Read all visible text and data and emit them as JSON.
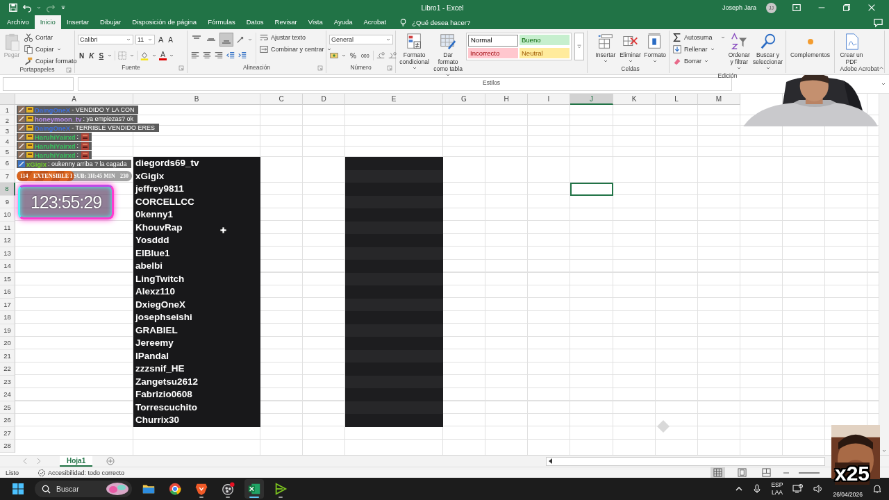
{
  "title_bar": {
    "title": "Libro1  -  Excel",
    "user": "Joseph Jara",
    "avatar": "JJ"
  },
  "ribbon_tabs": [
    {
      "label": "Archivo",
      "selected": false
    },
    {
      "label": "Inicio",
      "selected": true
    },
    {
      "label": "Insertar",
      "selected": false
    },
    {
      "label": "Dibujar",
      "selected": false
    },
    {
      "label": "Disposición de página",
      "selected": false
    },
    {
      "label": "Fórmulas",
      "selected": false
    },
    {
      "label": "Datos",
      "selected": false
    },
    {
      "label": "Revisar",
      "selected": false
    },
    {
      "label": "Vista",
      "selected": false
    },
    {
      "label": "Ayuda",
      "selected": false
    },
    {
      "label": "Acrobat",
      "selected": false
    }
  ],
  "tell_me": "¿Qué desea hacer?",
  "ribbon": {
    "clipboard": {
      "label": "Portapapeles",
      "paste": "Pegar",
      "paste_disabled": true,
      "cut": "Cortar",
      "copy": "Copiar",
      "format_painter": "Copiar formato"
    },
    "font": {
      "label": "Fuente",
      "face": "Calibri",
      "size": "11",
      "grow": "A",
      "shrink": "A",
      "bold": "N",
      "italic": "K",
      "underline": "S",
      "color_button": "A"
    },
    "alignment": {
      "label": "Alineación",
      "vertical": [
        {
          "selected": false
        },
        {
          "selected": false
        },
        {
          "selected": true
        }
      ],
      "wrap": "Ajustar texto",
      "merge": "Combinar y centrar"
    },
    "number": {
      "label": "Número",
      "format": "General",
      "percent": "%",
      "thousands": "000"
    },
    "styles": {
      "label": "Estilos",
      "conditional": "Formato condicional",
      "as_table": "Dar formato como tabla",
      "cell_styles": [
        {
          "label": "Normal",
          "kind": "normal"
        },
        {
          "label": "Bueno",
          "kind": "good"
        },
        {
          "label": "Incorrecto",
          "kind": "bad"
        },
        {
          "label": "Neutral",
          "kind": "neutral"
        }
      ]
    },
    "cells": {
      "label": "Celdas",
      "insert": "Insertar",
      "delete": "Eliminar",
      "format": "Formato"
    },
    "editing": {
      "label": "Edición",
      "autosum": "Autosuma",
      "fill": "Rellenar",
      "clear": "Borrar",
      "sort": "Ordenar y filtrar",
      "find": "Buscar y seleccionar"
    },
    "addins": {
      "button": "Complementos"
    },
    "acrobat": {
      "label": "Adobe Acrobat",
      "create_pdf": "Crear un PDF"
    }
  },
  "columns": [
    {
      "label": "A",
      "kind": "empty",
      "selected": false
    },
    {
      "label": "B",
      "kind": "names",
      "selected": false
    },
    {
      "label": "C",
      "kind": "empty",
      "selected": false
    },
    {
      "label": "D",
      "kind": "empty",
      "selected": false
    },
    {
      "label": "E",
      "kind": "shaded",
      "selected": false
    },
    {
      "label": "G",
      "kind": "empty",
      "selected": false
    },
    {
      "label": "H",
      "kind": "empty",
      "selected": false
    },
    {
      "label": "I",
      "kind": "empty",
      "selected": false
    },
    {
      "label": "J",
      "kind": "empty",
      "selected": true
    },
    {
      "label": "K",
      "kind": "empty",
      "selected": false
    },
    {
      "label": "L",
      "kind": "empty",
      "selected": false
    },
    {
      "label": "M",
      "kind": "empty",
      "selected": false
    }
  ],
  "rows": [
    {
      "label": "1",
      "filled": false,
      "selected": false
    },
    {
      "label": "2",
      "filled": false,
      "selected": false
    },
    {
      "label": "3",
      "filled": false,
      "selected": false
    },
    {
      "label": "4",
      "filled": false,
      "selected": false
    },
    {
      "label": "5",
      "filled": false,
      "selected": false
    },
    {
      "label": "6",
      "name": "diegords69_tv",
      "filled": true,
      "selected": false
    },
    {
      "label": "7",
      "name": "xGigix",
      "filled": true,
      "selected": false
    },
    {
      "label": "8",
      "name": "jeffrey9811",
      "filled": true,
      "selected": true
    },
    {
      "label": "9",
      "name": "CORCELLCC",
      "filled": true,
      "selected": false
    },
    {
      "label": "10",
      "name": "0kenny1",
      "filled": true,
      "selected": false
    },
    {
      "label": "11",
      "name": "KhouvRap",
      "filled": true,
      "selected": false
    },
    {
      "label": "12",
      "name": "Yosddd",
      "filled": true,
      "selected": false
    },
    {
      "label": "13",
      "name": "ElBlue1",
      "filled": true,
      "selected": false
    },
    {
      "label": "14",
      "name": "abelbi",
      "filled": true,
      "selected": false
    },
    {
      "label": "15",
      "name": "LingTwitch",
      "filled": true,
      "selected": false
    },
    {
      "label": "16",
      "name": "Alexz110",
      "filled": true,
      "selected": false
    },
    {
      "label": "17",
      "name": "DxiegOneX",
      "filled": true,
      "selected": false
    },
    {
      "label": "18",
      "name": "josephseishi",
      "filled": true,
      "selected": false
    },
    {
      "label": "19",
      "name": "GRABIEL",
      "filled": true,
      "selected": false
    },
    {
      "label": "20",
      "name": "Jereemy",
      "filled": true,
      "selected": false
    },
    {
      "label": "21",
      "name": "IPandal",
      "filled": true,
      "selected": false
    },
    {
      "label": "22",
      "name": "zzzsnif_HE",
      "filled": true,
      "selected": false
    },
    {
      "label": "23",
      "name": "Zangetsu2612",
      "filled": true,
      "selected": false
    },
    {
      "label": "24",
      "name": "Fabrizio0608",
      "filled": true,
      "selected": false
    },
    {
      "label": "25",
      "name": "Torrescuchito",
      "filled": true,
      "selected": false
    },
    {
      "label": "26",
      "name": "Churrix30",
      "filled": true,
      "selected": false
    },
    {
      "label": "27",
      "filled": false,
      "selected": false
    },
    {
      "label": "28",
      "filled": false,
      "selected": false
    }
  ],
  "sheet_tabs": [
    {
      "label": "Hoja1",
      "selected": true
    }
  ],
  "status_bar": {
    "status": "Listo",
    "accessibility": "Accesibilidad: todo correcto",
    "views": [
      {
        "kind": "normal",
        "selected": true
      },
      {
        "kind": "layout",
        "selected": false
      },
      {
        "kind": "breaks",
        "selected": false
      }
    ]
  },
  "chat": [
    {
      "user": "DaingOneX",
      "color": "#3d6fe0",
      "text": "- VENDIDO Y LA CON",
      "kind": "text",
      "subscriber": true
    },
    {
      "user": "honeymoon_tv",
      "color": "#b98cf0",
      "text": ": ya empiezas? ok",
      "kind": "text",
      "subscriber": true
    },
    {
      "user": "DaingOneX",
      "color": "#3d6fe0",
      "text": "- TERRIBLE VENDIDO ERES",
      "kind": "text",
      "subscriber": true
    },
    {
      "user": "HaruhiYairxd",
      "color": "#36c45c",
      "text": ":",
      "kind": "emote",
      "subscriber": true
    },
    {
      "user": "HaruhiYairxd",
      "color": "#36c45c",
      "text": ":",
      "kind": "emote",
      "subscriber": true
    },
    {
      "user": "HaruhiYairxd",
      "color": "#36c45c",
      "text": ":",
      "kind": "emote",
      "subscriber": true
    },
    {
      "user": "xGigix",
      "color": "#72d02c",
      "text": ": oukenny arriba ? la cagada",
      "kind": "text",
      "subscriber": false
    }
  ],
  "subathon": {
    "start": "114",
    "label": "EXTENSIBLE I SUB: 3H:45 MIN",
    "end": "230",
    "level": 0.5
  },
  "timer": "123:55:29",
  "gift_count": "x25",
  "taskbar": {
    "search": "Buscar",
    "apps": [
      {
        "kind": "folder",
        "running": false,
        "active": false
      },
      {
        "kind": "browser",
        "running": false,
        "active": false
      },
      {
        "kind": "shield",
        "running": true,
        "active": false
      },
      {
        "kind": "recorder",
        "running": true,
        "active": false
      },
      {
        "kind": "sheet",
        "running": true,
        "active": true
      },
      {
        "kind": "play",
        "running": true,
        "active": false
      }
    ],
    "language": "ESP",
    "layout": "LAA",
    "date": "26/04/2026"
  }
}
